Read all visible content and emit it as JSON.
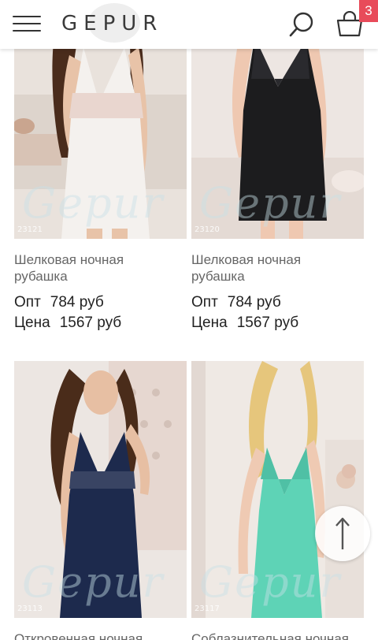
{
  "header": {
    "logo": "GEPUR",
    "cart_count": "3"
  },
  "products": [
    {
      "sku": "23121",
      "name_line1": "Шелковая ночная",
      "name_line2": "рубашка",
      "opt_label": "Опт",
      "opt_price": "784 руб",
      "price_label": "Цена",
      "price": "1567 руб"
    },
    {
      "sku": "23120",
      "name_line1": "Шелковая ночная",
      "name_line2": "рубашка",
      "opt_label": "Опт",
      "opt_price": "784 руб",
      "price_label": "Цена",
      "price": "1567 руб"
    },
    {
      "sku": "23113",
      "name_line1": "Откровенная ночная"
    },
    {
      "sku": "23117",
      "name_line1": "Соблазнительная ночная"
    }
  ],
  "colors": {
    "badge": "#e84b5a",
    "dress_white": "#f4f1ee",
    "dress_black": "#1c1c1e",
    "dress_navy": "#1d2a4d",
    "dress_mint": "#5ed3b6"
  }
}
